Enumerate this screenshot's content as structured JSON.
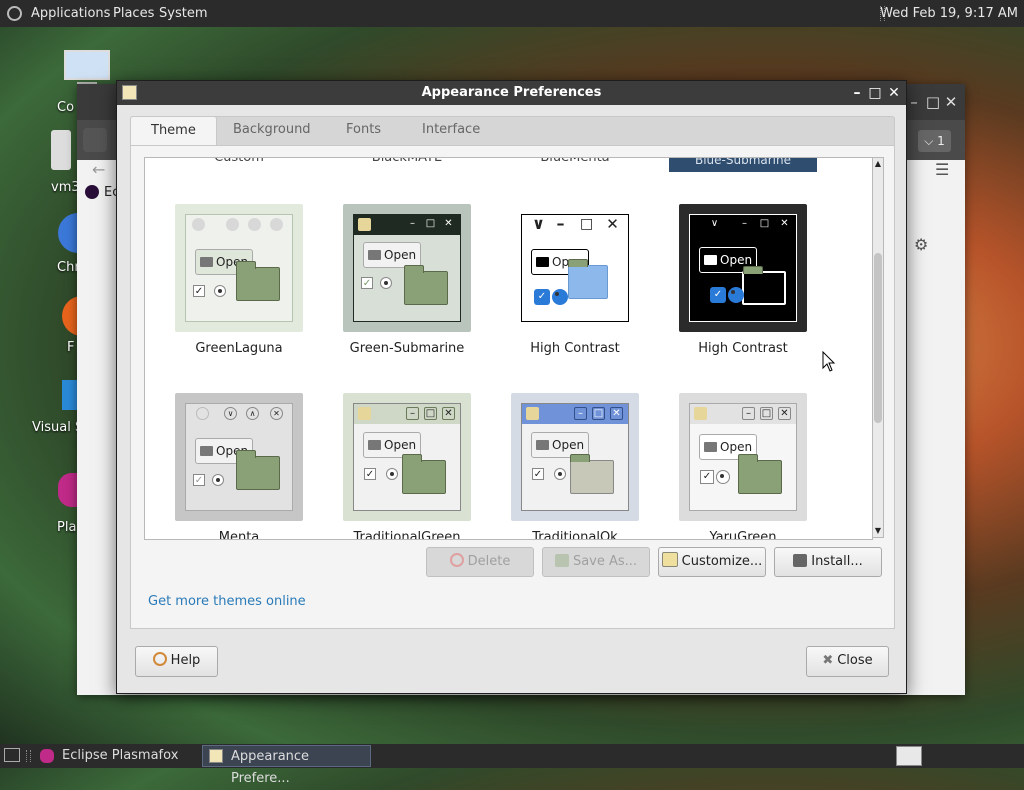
{
  "top_panel": {
    "menus": [
      "Applications",
      "Places",
      "System"
    ],
    "clock": "Wed Feb 19,  9:17 AM"
  },
  "desktop_icons": [
    "Co",
    "vm3",
    "Chr",
    "F",
    "Visual S",
    "Pla"
  ],
  "background_window": {
    "sidebar_label": "Ec",
    "tab_count": "1"
  },
  "dialog": {
    "title": "Appearance Preferences",
    "tabs": [
      "Theme",
      "Background",
      "Fonts",
      "Interface"
    ],
    "active_tab": "Theme",
    "previous_row_names": [
      "Custom",
      "BlackMATE",
      "BlueMenta",
      "Blue-Submarine"
    ],
    "themes": [
      {
        "name": "GreenLaguna",
        "icon": "greenlaguna-preview"
      },
      {
        "name": "Green-Submarine",
        "icon": "green-submarine-preview"
      },
      {
        "name": "High Contrast",
        "icon": "high-contrast-preview"
      },
      {
        "name": "High Contrast",
        "icon": "high-contrast-inverse-preview"
      },
      {
        "name": "Menta",
        "icon": "menta-preview"
      },
      {
        "name": "TraditionalGreen",
        "icon": "traditionalgreen-preview"
      },
      {
        "name": "TraditionalOk",
        "icon": "traditionalok-preview"
      },
      {
        "name": "YaruGreen",
        "icon": "yarugreen-preview"
      }
    ],
    "preview_open_label": "Open",
    "buttons": {
      "delete": "Delete",
      "save_as": "Save As...",
      "customize": "Customize...",
      "install": "Install..."
    },
    "get_more_link": "Get more themes online",
    "help": "Help",
    "close": "Close"
  },
  "taskbar": {
    "tasks": [
      "Eclipse Plasmafox",
      "Appearance Prefere..."
    ]
  },
  "colors": {
    "panel": "#2b2b2b",
    "selection": "#2f4d6e",
    "link": "#2a7ab8"
  }
}
